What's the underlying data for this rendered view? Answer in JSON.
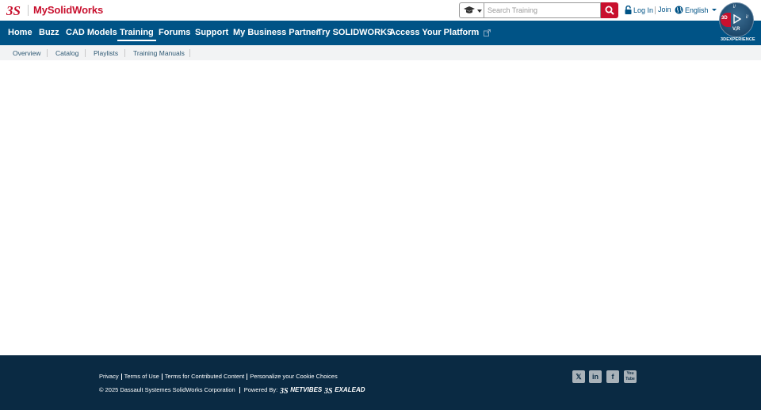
{
  "header": {
    "brand": "MySolidWorks",
    "search": {
      "placeholder": "Search Training",
      "value": ""
    },
    "login_label": "Log In",
    "join_label": "Join",
    "language_label": "English"
  },
  "nav": {
    "items": [
      {
        "label": "Home"
      },
      {
        "label": "Buzz"
      },
      {
        "label": "CAD Models"
      },
      {
        "label": "Training",
        "active": true
      },
      {
        "label": "Forums"
      },
      {
        "label": "Support"
      },
      {
        "label": "My Business Partner"
      },
      {
        "label": "Try SOLIDWORKS"
      },
      {
        "label": "Access Your Platform"
      }
    ]
  },
  "compass": {
    "left_label": "3D",
    "bottom_label": "V,R",
    "top_label": "i/",
    "right_label": "i/",
    "caption": "3DEXPERIENCE"
  },
  "subnav": {
    "items": [
      {
        "label": "Overview"
      },
      {
        "label": "Catalog"
      },
      {
        "label": "Playlists"
      },
      {
        "label": "Training Manuals"
      }
    ]
  },
  "footer": {
    "links": [
      {
        "label": "Privacy"
      },
      {
        "label": "Terms of Use"
      },
      {
        "label": "Terms for Contributed Content"
      },
      {
        "label": "Personalize your Cookie Choices"
      }
    ],
    "copyright": "© 2025 Dassault Systemes SolidWorks Corporation",
    "powered_by": "Powered By:",
    "netvibes": "NETVIBES",
    "exalead": "EXALEAD",
    "social": [
      {
        "icon": "x-icon",
        "glyph": "𝕏"
      },
      {
        "icon": "linkedin-icon",
        "glyph": "in"
      },
      {
        "icon": "facebook-icon",
        "glyph": "f"
      },
      {
        "icon": "youtube-icon",
        "glyph": "You Tube"
      }
    ]
  },
  "colors": {
    "brand_red": "#c8102e",
    "nav_blue": "#005386",
    "footer_navy": "#0a2a43"
  }
}
